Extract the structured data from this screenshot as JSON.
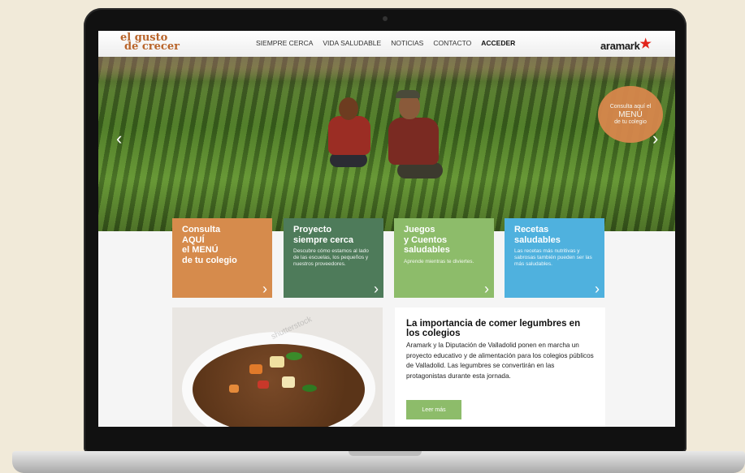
{
  "logo": {
    "line1": "el gusto",
    "line2": "de crecer"
  },
  "nav": {
    "items": [
      "SIEMPRE CERCA",
      "VIDA SALUDABLE",
      "NOTICIAS",
      "CONTACTO",
      "ACCEDER"
    ],
    "brand": "aramark"
  },
  "hero": {
    "badge": {
      "line1": "Consulta aquí el",
      "line2": "MENÚ",
      "line3": "de tu colegio"
    },
    "prev_arrow": "‹",
    "next_arrow": "›"
  },
  "tiles": [
    {
      "title": "Consulta\nAQUÍ\nel MENÚ\nde tu colegio",
      "text": "",
      "color": "#d68b4c"
    },
    {
      "title": "Proyecto\nsiempre cerca",
      "text": "Descubre cómo estamos al lado de las escuelas, los pequeños y nuestros proveedores.",
      "color": "#4e7b5a"
    },
    {
      "title": "Juegos\ny Cuentos\nsaludables",
      "text": "Aprende mientras te diviertes.",
      "color": "#8dbc6a"
    },
    {
      "title": "Recetas\nsaludables",
      "text": "Las recetas más nutritivas y sabrosas también pueden ser las más saludables.",
      "color": "#4fb1de"
    }
  ],
  "food_watermark": "shutterstock",
  "article": {
    "title": "La importancia de comer legumbres en los colegios",
    "body": "Aramark y la Diputación de Valladolid ponen en marcha un proyecto educativo y de alimentación para los colegios públicos de Valladolid. Las legumbres se convertirán en las protagonistas durante esta jornada.",
    "button": "Leer más"
  },
  "tile_chevron": "›"
}
